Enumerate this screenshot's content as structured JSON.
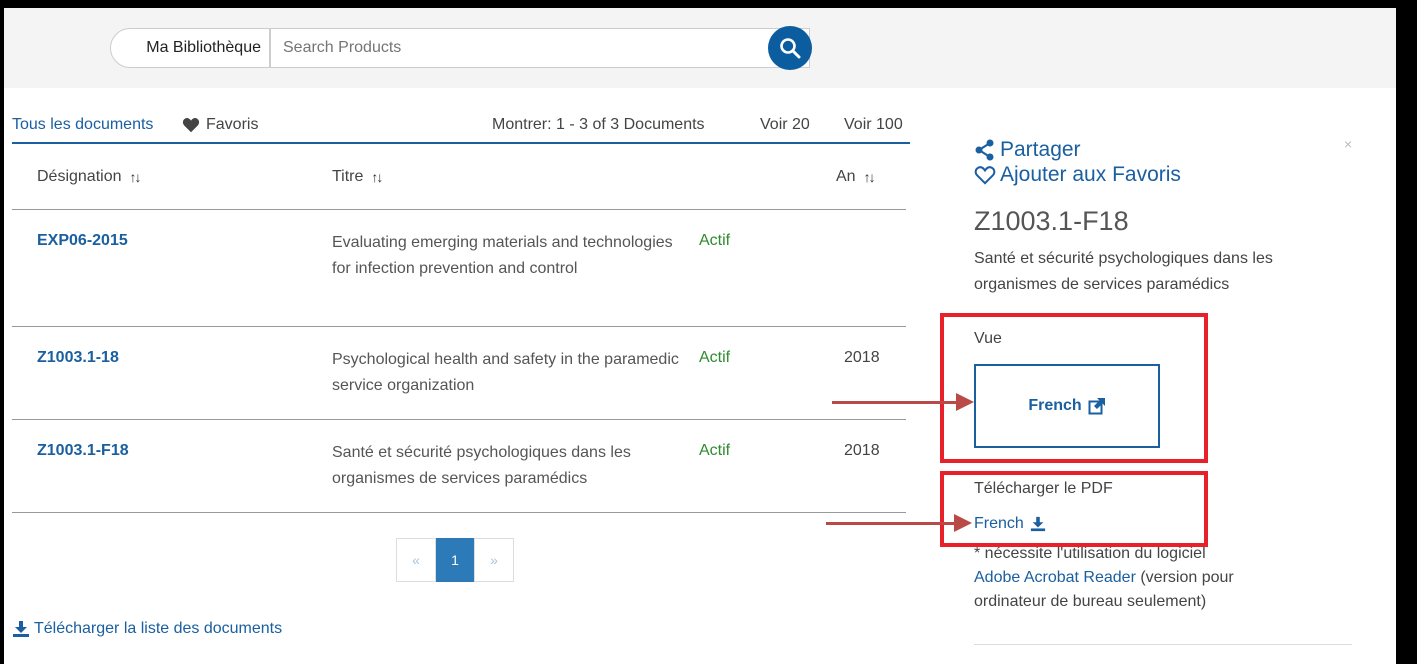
{
  "search": {
    "library_label": "Ma Bibliothèque",
    "placeholder": "Search Products"
  },
  "tabs": {
    "all": "Tous les documents",
    "favorites": "Favoris"
  },
  "listing": {
    "count_text": "Montrer: 1 - 3 of 3 Documents",
    "voir20": "Voir 20",
    "voir100": "Voir 100"
  },
  "table": {
    "headers": {
      "designation": "Désignation",
      "titre": "Titre",
      "an": "An"
    },
    "rows": [
      {
        "code": "EXP06-2015",
        "title": "Evaluating emerging materials and technologies for infection prevention and control",
        "status": "Actif",
        "year": ""
      },
      {
        "code": "Z1003.1-18",
        "title": "Psychological health and safety in the paramedic service organization",
        "status": "Actif",
        "year": "2018"
      },
      {
        "code": "Z1003.1-F18",
        "title": "Santé et sécurité psychologiques dans les organismes de services paramédics",
        "status": "Actif",
        "year": "2018"
      }
    ]
  },
  "pagination": {
    "prev": "«",
    "current": "1",
    "next": "»"
  },
  "download_list": "Télécharger la liste des documents",
  "panel": {
    "close": "×",
    "share": "Partager",
    "add_favorite": "Ajouter aux Favoris",
    "doc_id": "Z1003.1-F18",
    "description": "Santé et sécurité psychologiques dans les organismes de services paramédics",
    "vue_label": "Vue",
    "view_french": "French",
    "download_pdf_label": "Télécharger le PDF",
    "download_french": "French",
    "note_prefix": "* nécessite l'utilisation du logiciel",
    "note_link": "Adobe Acrobat Reader",
    "note_suffix": "(version pour ordinateur de bureau seulement)"
  },
  "colors": {
    "accent": "#1a5fa0",
    "active_green": "#2e8b2e",
    "annotation_red": "#e8202a"
  }
}
